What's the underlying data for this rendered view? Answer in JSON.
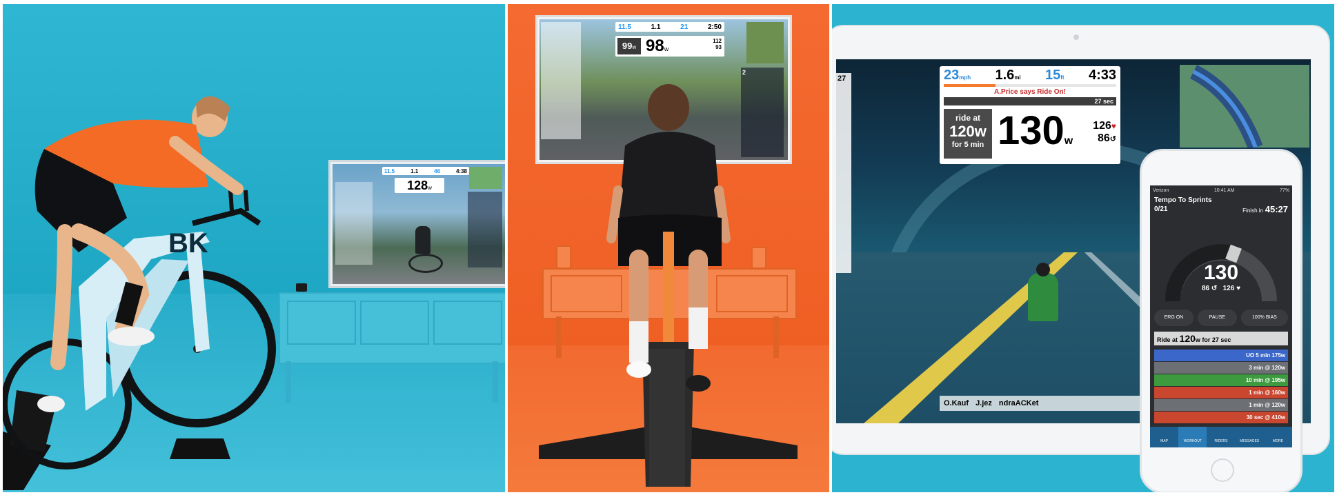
{
  "panel_left": {
    "tv_hud": {
      "speed": "11.5",
      "distance": "1.1",
      "elevation": "46",
      "time": "4:38",
      "power": "128",
      "power_unit": "w"
    },
    "bike_brand": "BK"
  },
  "panel_middle": {
    "tv_hud": {
      "speed": "11.5",
      "distance": "1.1",
      "elevation": "21",
      "time": "2:50",
      "target_power": "99",
      "target_unit": "w",
      "power": "98",
      "power_unit": "w",
      "hr": "112",
      "cadence": "93"
    },
    "tv_leaderboard_title": "2"
  },
  "panel_right": {
    "hud": {
      "speed": "23",
      "speed_unit": "mph",
      "distance": "1.6",
      "distance_unit": "mi",
      "elevation": "15",
      "elevation_unit": "ft",
      "time": "4:33",
      "ride_on_message": "A.Price says Ride On!",
      "interval_remaining": "27 sec",
      "interval_label_1": "ride at",
      "interval_target": "120w",
      "interval_label_2": "for 5 min",
      "power": "130",
      "power_unit": "w",
      "hr": "126",
      "cadence": "86",
      "left_value": "27"
    },
    "rider_flags_text": "O.Kauf",
    "rider_flags_text2": "J.jez",
    "rider_flags_text3": "ndraACKet",
    "phone": {
      "status_left": "Verizon",
      "status_center": "10:41 AM",
      "status_right": "77%",
      "workout_title": "Tempo To Sprints",
      "progress": "0/21",
      "finish_label": "Finish in",
      "finish_time": "45:27",
      "power": "130",
      "cadence": "86",
      "hr": "126",
      "ctrl_left": "ERG ON",
      "ctrl_mid": "PAUSE",
      "ctrl_right_pct": "100%",
      "ctrl_right_label": "BIAS",
      "current_interval_prefix": "Ride at",
      "current_interval_value": "120",
      "current_interval_suffix": "w for 27 sec",
      "intervals": [
        {
          "label": "UO 5 min 175w",
          "color": "#3a67c9"
        },
        {
          "label": "3 min @ 120w",
          "color": "#6c6f74"
        },
        {
          "label": "10 min @ 195w",
          "color": "#3e9a3f"
        },
        {
          "label": "1 min @ 160w",
          "color": "#c9462f"
        },
        {
          "label": "1 min @ 120w",
          "color": "#6c6f74"
        },
        {
          "label": "30 sec @ 410w",
          "color": "#c9462f"
        }
      ],
      "tabs": [
        "MAP",
        "WORKOUT",
        "RIDERS",
        "MESSAGES",
        "MORE"
      ]
    }
  }
}
